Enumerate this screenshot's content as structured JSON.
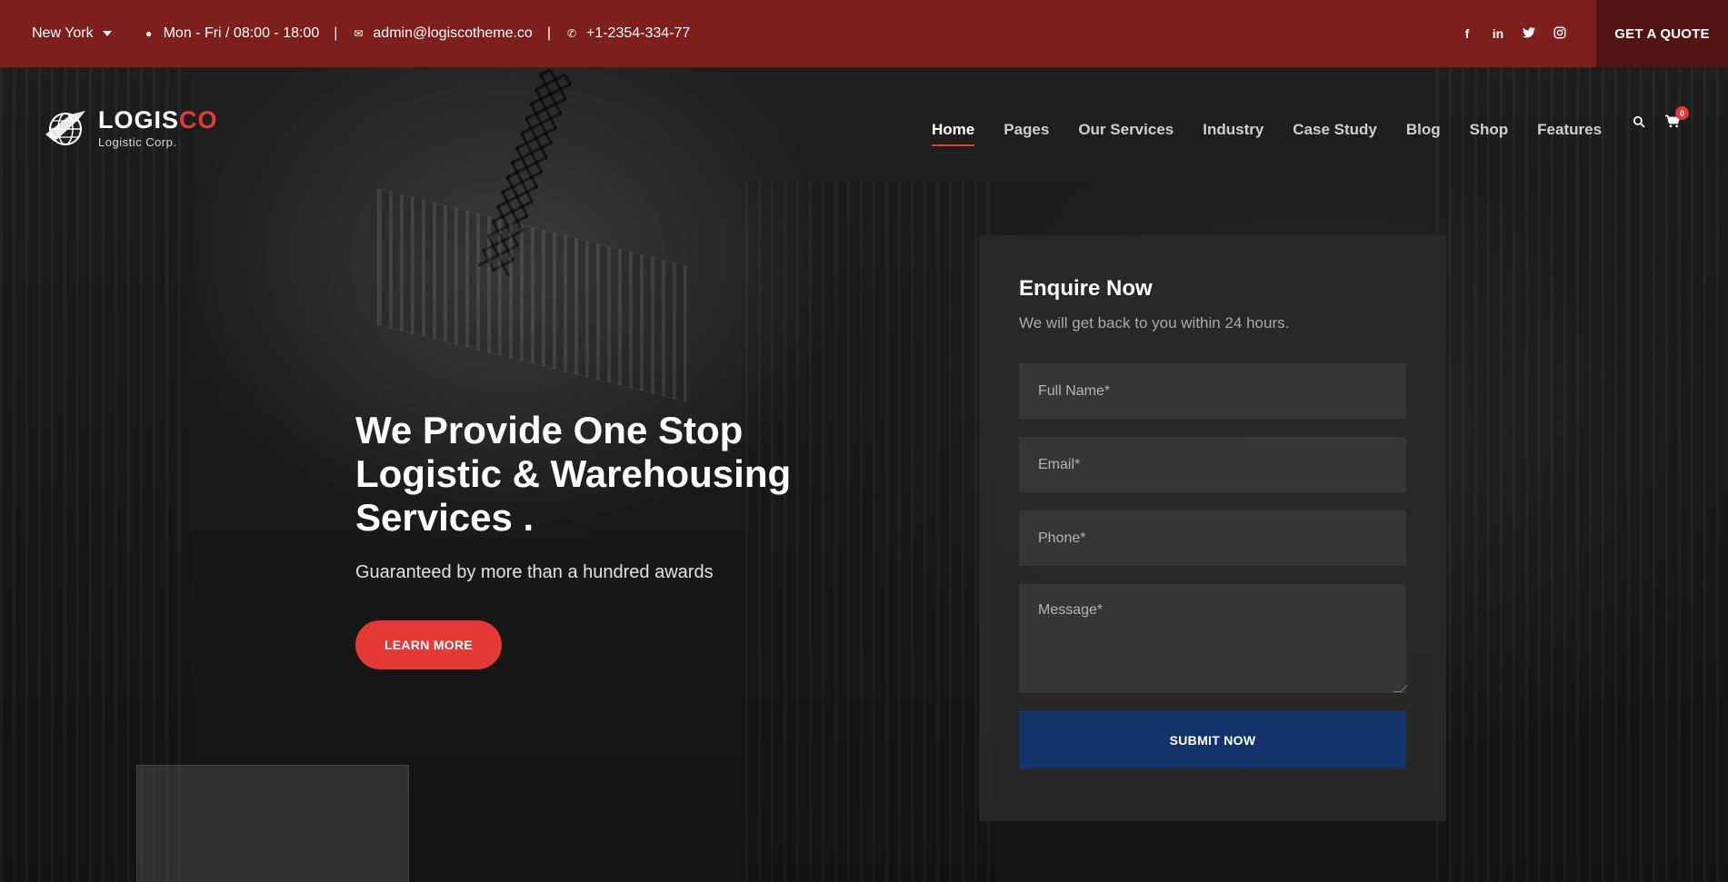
{
  "topbar": {
    "location": "New York",
    "hours": "Mon - Fri / 08:00 - 18:00",
    "email": "admin@logiscotheme.co",
    "phone": "+1-2354-334-77",
    "separator": "|",
    "social": [
      {
        "name": "facebook-icon",
        "glyph": "f"
      },
      {
        "name": "linkedin-icon",
        "glyph": "in"
      },
      {
        "name": "twitter-icon",
        "glyph": "🐦"
      },
      {
        "name": "instagram-icon",
        "glyph": "◎"
      }
    ],
    "cta": "GET A QUOTE"
  },
  "brand": {
    "name_main": "LOGIS",
    "name_accent": "CO",
    "tagline": "Logistic Corp."
  },
  "nav": {
    "items": [
      "Home",
      "Pages",
      "Our Services",
      "Industry",
      "Case Study",
      "Blog",
      "Shop",
      "Features"
    ],
    "active": "Home",
    "cart_count": "0"
  },
  "hero": {
    "title": "We Provide One Stop Logistic & Warehousing Services .",
    "subtitle": "Guaranteed by more than a hundred awards",
    "button": "LEARN MORE"
  },
  "form": {
    "title": "Enquire Now",
    "subtitle": "We will get back to you within 24 hours.",
    "placeholders": {
      "name": "Full Name*",
      "email": "Email*",
      "phone": "Phone*",
      "message": "Message*"
    },
    "submit": "SUBMIT NOW"
  },
  "colors": {
    "topbar": "#7e1e1d",
    "quote_button": "#521413",
    "accent_red": "#e53935",
    "submit_blue": "#13346b"
  }
}
